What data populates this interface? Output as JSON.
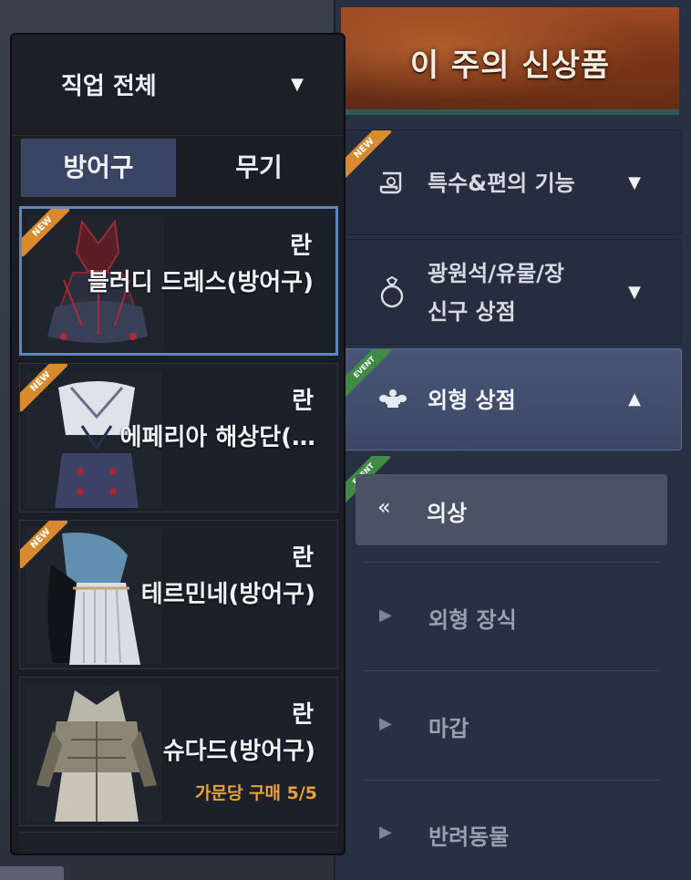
{
  "banner": {
    "title": "이 주의 신상품"
  },
  "filter": {
    "job_label": "직업 전체"
  },
  "tabs": [
    {
      "label": "방어구",
      "selected": true
    },
    {
      "label": "무기",
      "selected": false
    }
  ],
  "items": [
    {
      "class": "란",
      "name": "블러디 드레스(방어구)",
      "badge": "NEW",
      "selected": true
    },
    {
      "class": "란",
      "name": "에페리아 해상단(…",
      "badge": "NEW",
      "selected": false
    },
    {
      "class": "란",
      "name": "테르민네(방어구)",
      "badge": "NEW",
      "selected": false
    },
    {
      "class": "란",
      "name": "슈다드(방어구)",
      "limit": "가문당 구매 5/5",
      "selected": false
    }
  ],
  "categories": [
    {
      "label": "특수&편의 기능",
      "icon": "scroll-icon",
      "badge": "NEW",
      "expanded": false
    },
    {
      "label_line1": "광원석/유물/장",
      "label_line2": "신구 상점",
      "icon": "ring-icon",
      "expanded": false
    },
    {
      "label": "외형 상점",
      "icon": "crown-icon",
      "badge": "EVENT",
      "expanded": true
    }
  ],
  "subcategories": [
    {
      "label": "의상",
      "badge": "EVENT",
      "selected": true
    },
    {
      "label": "외형 장식",
      "selected": false
    },
    {
      "label": "마갑",
      "selected": false
    },
    {
      "label": "반려동물",
      "selected": false
    }
  ],
  "colors": {
    "selected_border": "#5f86b8",
    "limit_text": "#e8a23a",
    "new_ribbon": "#d98a2c",
    "event_ribbon": "#3f8a45"
  }
}
